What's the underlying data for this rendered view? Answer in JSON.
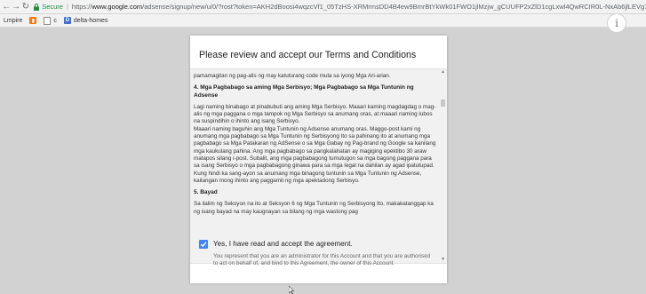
{
  "browser": {
    "secure_label": "Secure",
    "url_prefix": "https://",
    "url_host": "www.google.com",
    "url_path": "/adsense/signup/new/u/0/?rost?token=AKH2dBoosi4wqzcVf1_05TzHS-XRMrmsDD4B4ew9BmrBtYkWk01FWO1jlMzjw_gCUUFP2xZlD1cgLxwl4QwRCIR0L-NxAb6jlLEVg7pv...",
    "separator": "|"
  },
  "bookmarks": [
    {
      "label": "Lmpire",
      "icon": "text"
    },
    {
      "label": "",
      "icon": "orange-square-icon"
    },
    {
      "label": "c",
      "icon": "page-icon"
    },
    {
      "label": "delta-homes",
      "icon": "d-icon"
    }
  ],
  "dialog": {
    "title": "Please review and accept our Terms and Conditions",
    "terms": {
      "intro_line": "pamamagitan ng pag-alis ng may katuturang code mula sa iyong Mga Ari-arian.",
      "section4_heading": "4. Mga Pagbabago sa aming Mga Serbisyo; Mga Pagbabago sa Mga Tuntunin ng Adsense",
      "section4_p1": "Lagi naming binabago at pinabubuti ang aming Mga Serbisyo. Maaari kaming magdagdag o mag-alis ng mga paggana o mga tampok ng Mga Serbisyo sa anumang oras, at maaari naming lubos na suspindihin o ihinto ang isang Serbisyo.",
      "section4_p2": "Maaari naming baguhin ang Mga Tuntunin ng Adsense anumang oras. Maggo-post kami ng anumang mga pagbabago sa Mga Tuntunin ng Serbisyong Ito sa pahinang ito at anumang mga pagbabago sa Mga Patakaran ng AdSense o sa Mga Gabay ng Pag-brand ng Google sa kanilang mga kaukulang pahina. Ang mga pagbabago sa pangkalahatan ay magiging epektibo 30 araw matapos silang i-post. Subalit, ang mga pagbabagong tumutugon sa mga bagong paggana para sa isang Serbisyo o mga pagbabagong ginawa para sa mga legal na dahilan ay agad ipatutupad. Kung hindi ka sang-ayon sa anumang mga binagong tuntunin sa Mga Tuntunin ng Adsense, kailangan mong ihinto ang paggamit ng mga apektadong Serbisyo.",
      "section5_heading": "5. Bayad",
      "section5_p1": "Sa ilalim ng Seksyon na ito at Seksyon 6 ng Mga Tuntunin ng Serbisyong Ito, makakatanggap ka ng isang bayad na may kaugnayan sa bilang ng mga wastong pag"
    },
    "agree_label": "Yes, I have read and accept the agreement.",
    "agree_checked": true,
    "agree_description": "You represent that you are an administrator for this Account and that you are authorised to act on behalf of, and bind to this Agreement, the owner of this Account."
  },
  "info_button_label": "i",
  "colors": {
    "checkbox_accent": "#4285f4",
    "secure_green": "#1e8e3e",
    "background": "#d2d2d2"
  }
}
